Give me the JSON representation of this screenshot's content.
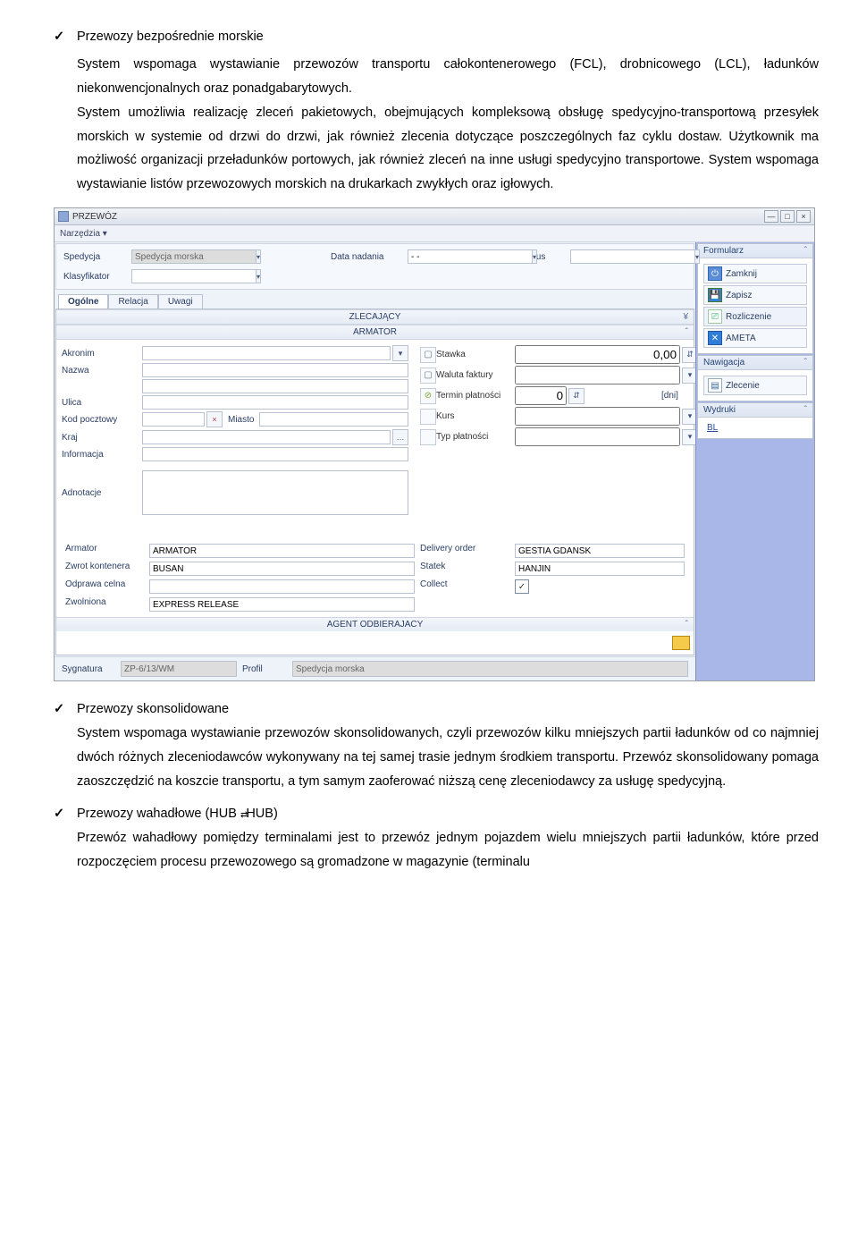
{
  "doc": {
    "sec1_title": "Przewozy bezpośrednie morskie",
    "sec1_p1": "System wspomaga wystawianie przewozów transportu całokontenerowego (FCL), drobnicowego (LCL), ładunków niekonwencjonalnych oraz ponadgabarytowych.",
    "sec1_p2": "System umożliwia realizację zleceń pakietowych, obejmujących kompleksową obsługę spedycyjno-transportową przesyłek morskich w systemie od drzwi do drzwi, jak również zlecenia dotyczące poszczególnych faz cyklu dostaw. Użytkownik ma możliwość organizacji przeładunków portowych, jak również zleceń na inne usługi spedycyjno transportowe. System wspomaga wystawianie listów przewozowych morskich na drukarkach zwykłych oraz igłowych.",
    "sec2_title": "Przewozy skonsolidowane",
    "sec2_p": "System wspomaga wystawianie przewozów skonsolidowanych, czyli przewozów kilku mniejszych partii ładunków od co najmniej dwóch różnych zleceniodawców wykonywany na tej samej trasie jednym środkiem transportu. Przewóz skonsolidowany pomaga zaoszczędzić na koszcie transportu, a tym samym zaoferować niższą cenę zleceniodawcy za usługę spedycyjną.",
    "sec3_title_pre": "Przewozy wahadłowe (HUB ",
    "sec3_title_post": "HUB)",
    "sec3_p": "Przewóz wahadłowy pomiędzy terminalami jest to przewóz jednym pojazdem wielu mniejszych partii ładunków, które przed rozpoczęciem procesu przewozowego są gromadzone w magazynie (terminalu"
  },
  "ui": {
    "title": "PRZEWÓZ",
    "toolbar": {
      "narzedzia": "Narzędzia"
    },
    "filter": {
      "spedycja_lbl": "Spedycja",
      "spedycja_val": "Spedycja morska",
      "klasyfikator_lbl": "Klasyfikator",
      "data_nadania_lbl": "Data nadania",
      "data_nadania_val": "- -",
      "status_lbl": "Status"
    },
    "tabs": {
      "t1": "Ogólne",
      "t2": "Relacja",
      "t3": "Uwagi"
    },
    "sections": {
      "zlecajacy": "ZLECAJĄCY",
      "armator": "ARMATOR",
      "agent": "AGENT ODBIERAJACY"
    },
    "left_form": {
      "akronim": "Akronim",
      "nazwa": "Nazwa",
      "ulica": "Ulica",
      "kod": "Kod pocztowy",
      "miasto_lbl": "Miasto",
      "kraj": "Kraj",
      "info": "Informacja",
      "adnotacje": "Adnotacje"
    },
    "right_form": {
      "stawka": "Stawka",
      "stawka_val": "0,00",
      "waluta": "Waluta faktury",
      "termin": "Termin płatności",
      "termin_val": "0",
      "termin_suf": "[dni]",
      "kurs": "Kurs",
      "typ": "Typ płatności"
    },
    "bottom": {
      "armator_lbl": "Armator",
      "armator_val": "ARMATOR",
      "zwrot_lbl": "Zwrot kontenera",
      "zwrot_val": "BUSAN",
      "odprawa_lbl": "Odprawa celna",
      "zwolniona_lbl": "Zwolniona",
      "zwolniona_val": "EXPRESS RELEASE",
      "delivery_lbl": "Delivery order",
      "delivery_val": "GESTIA GDAŃSK",
      "statek_lbl": "Statek",
      "statek_val": "HANJIN",
      "collect_lbl": "Collect"
    },
    "status": {
      "sygnatura_lbl": "Sygnatura",
      "sygnatura_val": "ZP-6/13/WM",
      "profil_lbl": "Profil",
      "profil_val": "Spedycja morska"
    },
    "side": {
      "formularz": "Formularz",
      "zamknij": "Zamknij",
      "zapisz": "Zapisz",
      "rozliczenie": "Rozliczenie",
      "ameta": "AMETA",
      "nawigacja": "Nawigacja",
      "zlecenie": "Zlecenie",
      "wydruki": "Wydruki",
      "bl": "BL"
    }
  }
}
